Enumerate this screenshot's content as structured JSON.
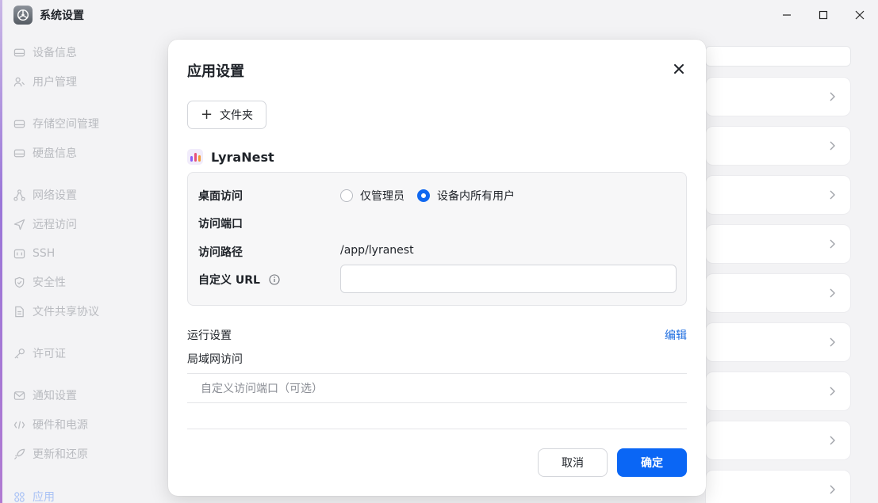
{
  "window": {
    "title": "系统设置",
    "app_icon": "settings-gear-icon"
  },
  "sidebar": {
    "items": [
      {
        "label": "设备信息",
        "icon": "drive-icon"
      },
      {
        "label": "用户管理",
        "icon": "users-icon"
      },
      {
        "label": "存储空间管理",
        "icon": "storage-icon"
      },
      {
        "label": "硬盘信息",
        "icon": "disk-icon"
      },
      {
        "label": "网络设置",
        "icon": "network-icon"
      },
      {
        "label": "远程访问",
        "icon": "send-icon"
      },
      {
        "label": "SSH",
        "icon": "terminal-icon"
      },
      {
        "label": "安全性",
        "icon": "shield-icon"
      },
      {
        "label": "文件共享协议",
        "icon": "file-icon"
      },
      {
        "label": "许可证",
        "icon": "key-icon"
      },
      {
        "label": "通知设置",
        "icon": "mail-icon"
      },
      {
        "label": "硬件和电源",
        "icon": "power-icon"
      },
      {
        "label": "更新和还原",
        "icon": "rocket-icon"
      },
      {
        "label": "应用",
        "icon": "apps-grid-icon",
        "active": true
      }
    ]
  },
  "dialog": {
    "title": "应用设置",
    "add_folder_label": "文件夹",
    "app_name": "LyraNest",
    "desktop_access_label": "桌面访问",
    "radio_admin_only": "仅管理员",
    "radio_all_users": "设备内所有用户",
    "selected_option": "设备内所有用户",
    "access_port_label": "访问端口",
    "access_path_label": "访问路径",
    "access_path_value": "/app/lyranest",
    "custom_url_label": "自定义 URL",
    "custom_url_value": "",
    "run_settings_label": "运行设置",
    "edit_label": "编辑",
    "lan_access_label": "局域网访问",
    "custom_port_label": "自定义访问端口（可选）",
    "cancel_label": "取消",
    "confirm_label": "确定"
  },
  "colors": {
    "primary": "#0a66f5",
    "link": "#1a6be0",
    "sidebar_text": "#b9bbc0"
  }
}
